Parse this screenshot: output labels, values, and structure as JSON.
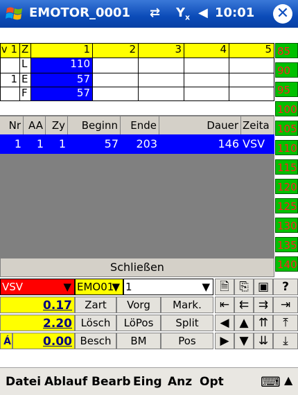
{
  "titlebar": {
    "title": "EMOTOR_0001",
    "sync_icon": "sync-arrows-icon",
    "signal_icon": "no-signal-icon",
    "volume_icon": "speaker-icon",
    "time": "10:01",
    "close": "✕"
  },
  "grid": {
    "header": [
      "v 1",
      "Z",
      "1",
      "2",
      "3",
      "4",
      "5"
    ],
    "rows": [
      {
        "v": "",
        "z": "L",
        "val": "110"
      },
      {
        "v": "1",
        "z": "E",
        "val": "57"
      },
      {
        "v": "",
        "z": "F",
        "val": "57"
      }
    ]
  },
  "side_scale": [
    "85",
    "90",
    "95",
    "100",
    "105",
    "110",
    "115",
    "120",
    "125",
    "130",
    "135",
    "140"
  ],
  "list": {
    "headers": [
      "Nr",
      "AA",
      "Zy",
      "Beginn",
      "Ende",
      "Dauer",
      "Zeita"
    ],
    "rows": [
      {
        "nr": "1",
        "aa": "1",
        "zy": "1",
        "beginn": "57",
        "ende": "203",
        "dauer": "146",
        "zeit": "VSV"
      }
    ]
  },
  "close_button": "Schließen",
  "controls": {
    "select1": "VSV",
    "select2": "EMO01",
    "select3": "1",
    "values": [
      "0.17",
      "2.20",
      "0.00"
    ],
    "side_label": "Á",
    "buttons_row1": [
      "Zart",
      "Vorg",
      "Mark."
    ],
    "buttons_row2": [
      "Lösch",
      "LöPos",
      "Split"
    ],
    "buttons_row3": [
      "Besch",
      "BM",
      "Pos"
    ]
  },
  "menu": [
    "Datei",
    "Ablauf",
    "Bearb",
    "Eing",
    "Anz",
    "Opt"
  ],
  "colors": {
    "title_blue": "#0b4bb8",
    "yellow": "#ffff00",
    "blue": "#0000ff",
    "green": "#00c000",
    "red": "#ff0000"
  }
}
